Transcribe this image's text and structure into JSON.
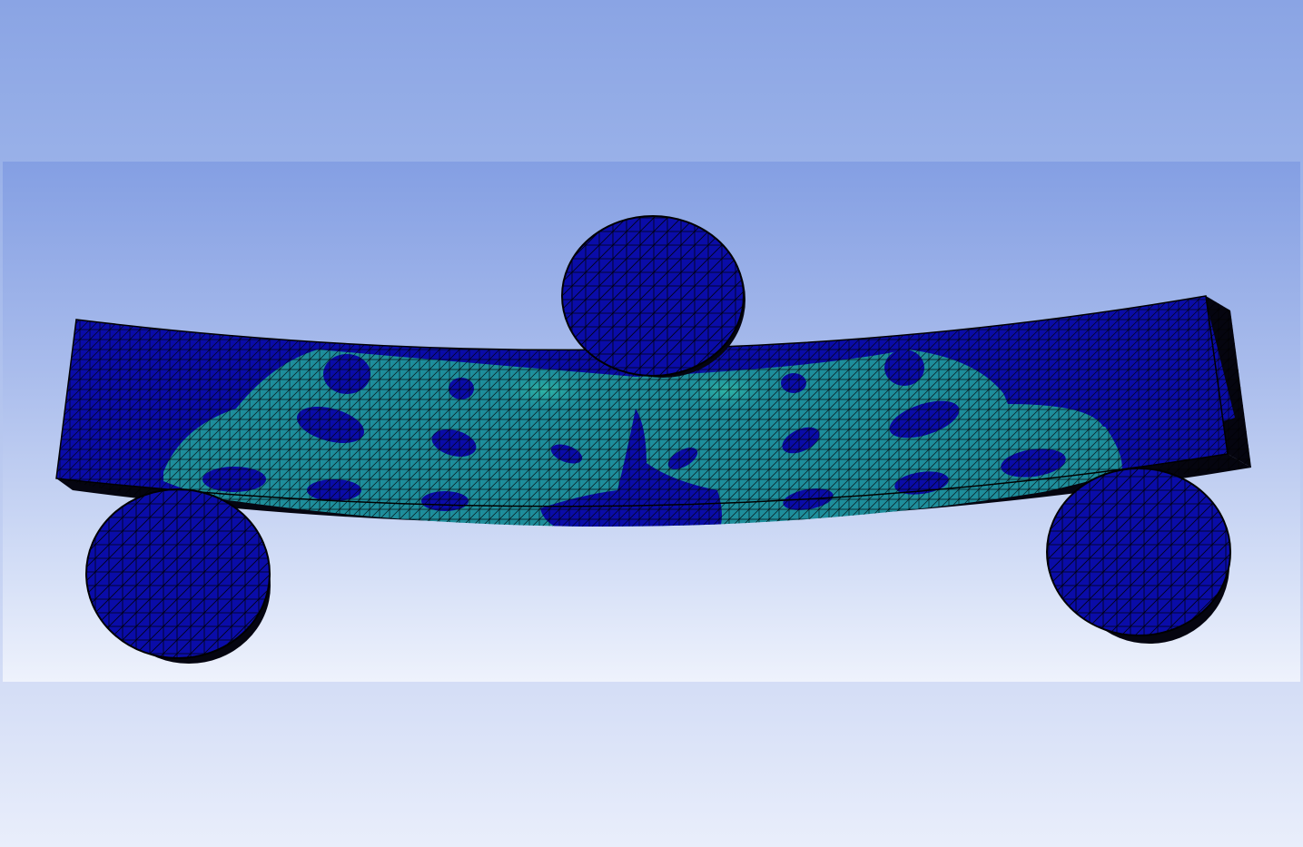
{
  "viewport": {
    "background_top": "#8aa4e4",
    "background_bottom": "#e9eefb"
  },
  "model": {
    "body_color": "#0a0ca8",
    "stress_color": "#1e8e9c",
    "hotspot_color": "#2fb5a6",
    "edge_color": "#000000",
    "icons": {
      "beam": "beam-mesh-icon",
      "loading_roller": "cylinder-roller-icon",
      "support_roller_left": "cylinder-roller-icon",
      "support_roller_right": "cylinder-roller-icon"
    }
  }
}
